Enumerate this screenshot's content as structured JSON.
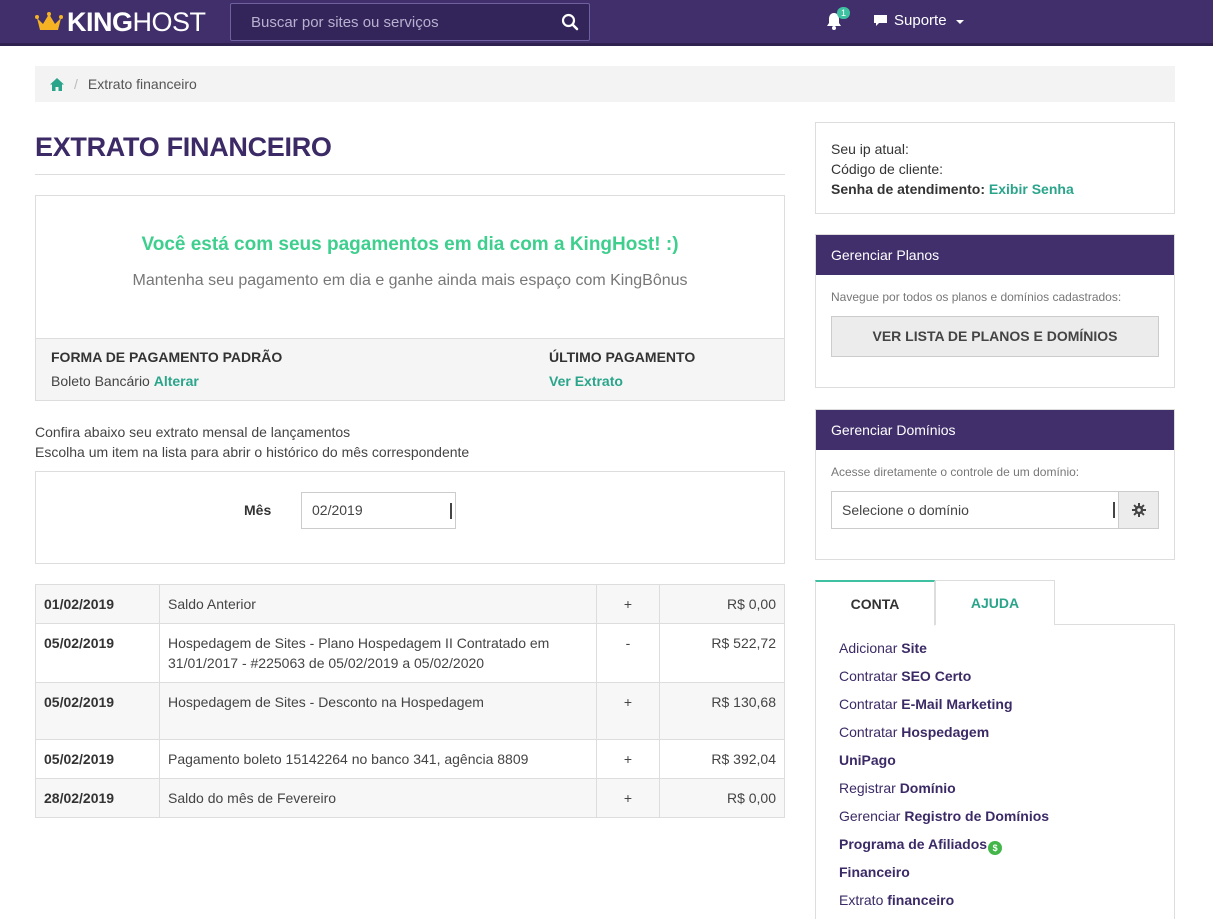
{
  "header": {
    "brand_king": "KING",
    "brand_host": "HOST",
    "search_placeholder": "Buscar por sites ou serviços",
    "notification_count": "1",
    "support_label": "Suporte"
  },
  "breadcrumb": {
    "current": "Extrato financeiro"
  },
  "page": {
    "title": "EXTRATO FINANCEIRO"
  },
  "status": {
    "headline": "Você está com seus pagamentos em dia com a KingHost! :)",
    "subtext": "Mantenha seu pagamento em dia e ganhe ainda mais espaço com KingBônus",
    "payment_method_heading": "FORMA DE PAGAMENTO PADRÃO",
    "payment_method_value": "Boleto Bancário",
    "payment_method_action": "Alterar",
    "last_payment_heading": "ÚLTIMO PAGAMENTO",
    "last_payment_action": "Ver Extrato"
  },
  "intro": {
    "line1": "Confira abaixo seu extrato mensal de lançamentos",
    "line2": "Escolha um item na lista para abrir o histórico do mês correspondente"
  },
  "month_filter": {
    "label": "Mês",
    "selected": "02/2019"
  },
  "ledger": [
    {
      "date": "01/02/2019",
      "description": "Saldo Anterior",
      "sign": "+",
      "value": "R$ 0,00"
    },
    {
      "date": "05/02/2019",
      "description": "Hospedagem de Sites - Plano Hospedagem II Contratado em 31/01/2017 - #225063 de 05/02/2019 a 05/02/2020",
      "sign": "-",
      "value": "R$ 522,72"
    },
    {
      "date": "05/02/2019",
      "description": "Hospedagem de Sites - Desconto na Hospedagem",
      "sign": "+",
      "value": "R$ 130,68"
    },
    {
      "date": "05/02/2019",
      "description": "Pagamento boleto 15142264 no banco 341, agência 8809",
      "sign": "+",
      "value": "R$ 392,04"
    },
    {
      "date": "28/02/2019",
      "description": "Saldo do mês de Fevereiro",
      "sign": "+",
      "value": "R$ 0,00"
    }
  ],
  "account_info": {
    "ip_label": "Seu ip atual:",
    "client_code_label": "Código de cliente:",
    "support_password_label": "Senha de atendimento:",
    "support_password_action": "Exibir Senha"
  },
  "plans_panel": {
    "title": "Gerenciar Planos",
    "hint": "Navegue por todos os planos e domínios cadastrados:",
    "button": "VER LISTA DE PLANOS E DOMÍNIOS"
  },
  "domains_panel": {
    "title": "Gerenciar Domínios",
    "hint": "Acesse diretamente o controle de um domínio:",
    "select_placeholder": "Selecione o domínio"
  },
  "tabs": {
    "account": "CONTA",
    "help": "AJUDA"
  },
  "account_links": [
    {
      "prefix": "Adicionar ",
      "bold": "Site"
    },
    {
      "prefix": "Contratar ",
      "bold": "SEO Certo"
    },
    {
      "prefix": "Contratar ",
      "bold": "E-Mail Marketing"
    },
    {
      "prefix": "Contratar ",
      "bold": "Hospedagem"
    },
    {
      "prefix": "",
      "bold": "UniPago"
    },
    {
      "prefix": "Registrar ",
      "bold": "Domínio"
    },
    {
      "prefix": "Gerenciar ",
      "bold": "Registro de Domínios"
    },
    {
      "prefix": "",
      "bold": "Programa de Afiliados"
    },
    {
      "prefix": "",
      "bold": "Financeiro"
    },
    {
      "prefix": "Extrato ",
      "bold": "financeiro"
    }
  ],
  "colors": {
    "brand_purple": "#412f6c",
    "accent_teal": "#2aa58b",
    "success_green": "#3ecf8e",
    "crown_gold": "#f5b324"
  },
  "icons": [
    "crown-logo-icon",
    "search-icon",
    "bell-icon",
    "chat-icon",
    "home-icon",
    "gear-icon",
    "dollar-icon"
  ]
}
